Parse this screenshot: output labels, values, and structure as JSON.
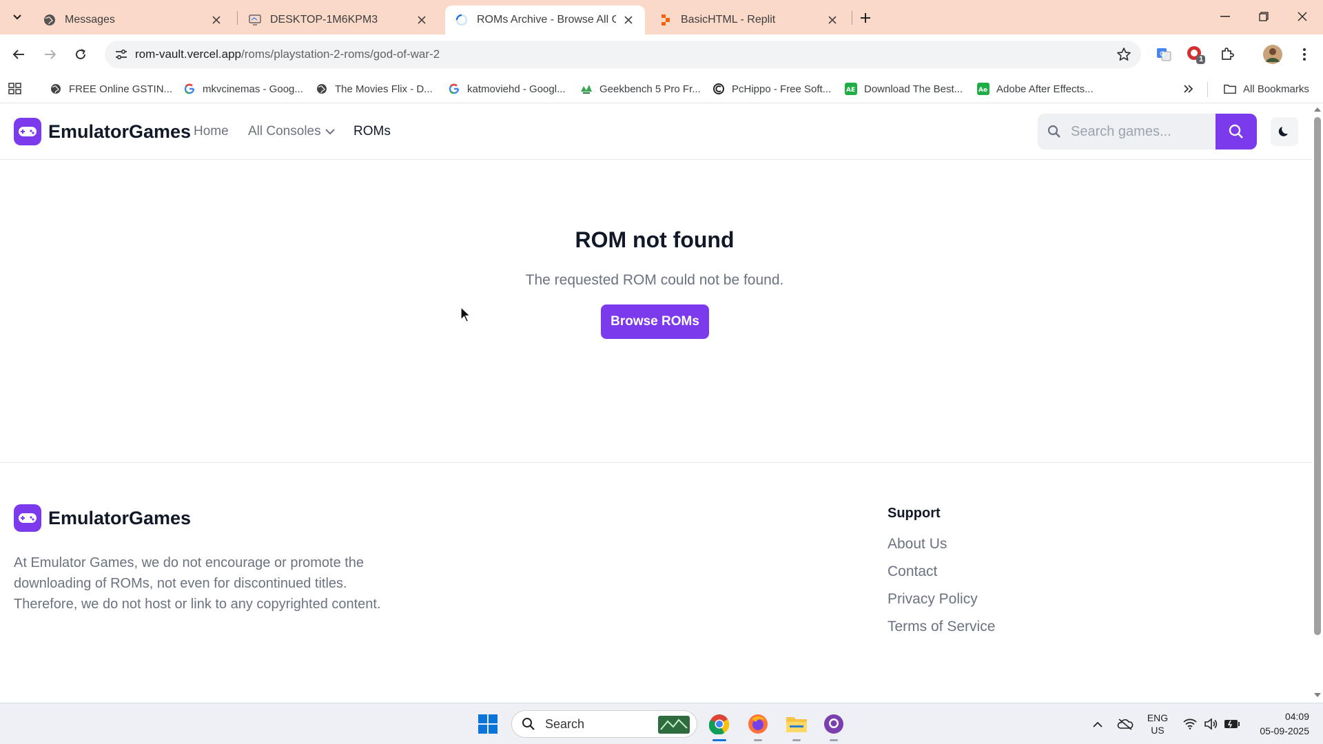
{
  "browser": {
    "tabs": [
      {
        "title": "Messages"
      },
      {
        "title": "DESKTOP-1M6KPM3"
      },
      {
        "title": "ROMs Archive - Browse All Games"
      },
      {
        "title": "BasicHTML - Replit"
      }
    ],
    "url_host": "rom-vault.vercel.app",
    "url_path": "/roms/playstation-2-roms/god-of-war-2",
    "extension_badge": "1",
    "bookmarks": [
      {
        "label": "FREE Online GSTIN..."
      },
      {
        "label": "mkvcinemas - Goog..."
      },
      {
        "label": "The Movies Flix - D..."
      },
      {
        "label": "katmoviehd - Googl..."
      },
      {
        "label": "Geekbench 5 Pro Fr..."
      },
      {
        "label": "PcHippo - Free Soft..."
      },
      {
        "label": "Download The Best..."
      },
      {
        "label": "Adobe After Effects..."
      }
    ],
    "all_bookmarks": "All Bookmarks"
  },
  "site": {
    "brand": "EmulatorGames",
    "nav": {
      "home": "Home",
      "consoles": "All Consoles",
      "roms": "ROMs"
    },
    "search_placeholder": "Search games...",
    "brand_color": "#7c3aed"
  },
  "main": {
    "title": "ROM not found",
    "message": "The requested ROM could not be found.",
    "button": "Browse ROMs"
  },
  "footer": {
    "brand": "EmulatorGames",
    "description": "At Emulator Games, we do not encourage or promote the downloading of ROMs, not even for discontinued titles. Therefore, we do not host or link to any copyrighted content.",
    "support_heading": "Support",
    "links": [
      "About Us",
      "Contact",
      "Privacy Policy",
      "Terms of Service"
    ]
  },
  "taskbar": {
    "search_label": "Search",
    "lang_line1": "ENG",
    "lang_line2": "US",
    "time": "04:09",
    "date": "05-09-2025"
  }
}
